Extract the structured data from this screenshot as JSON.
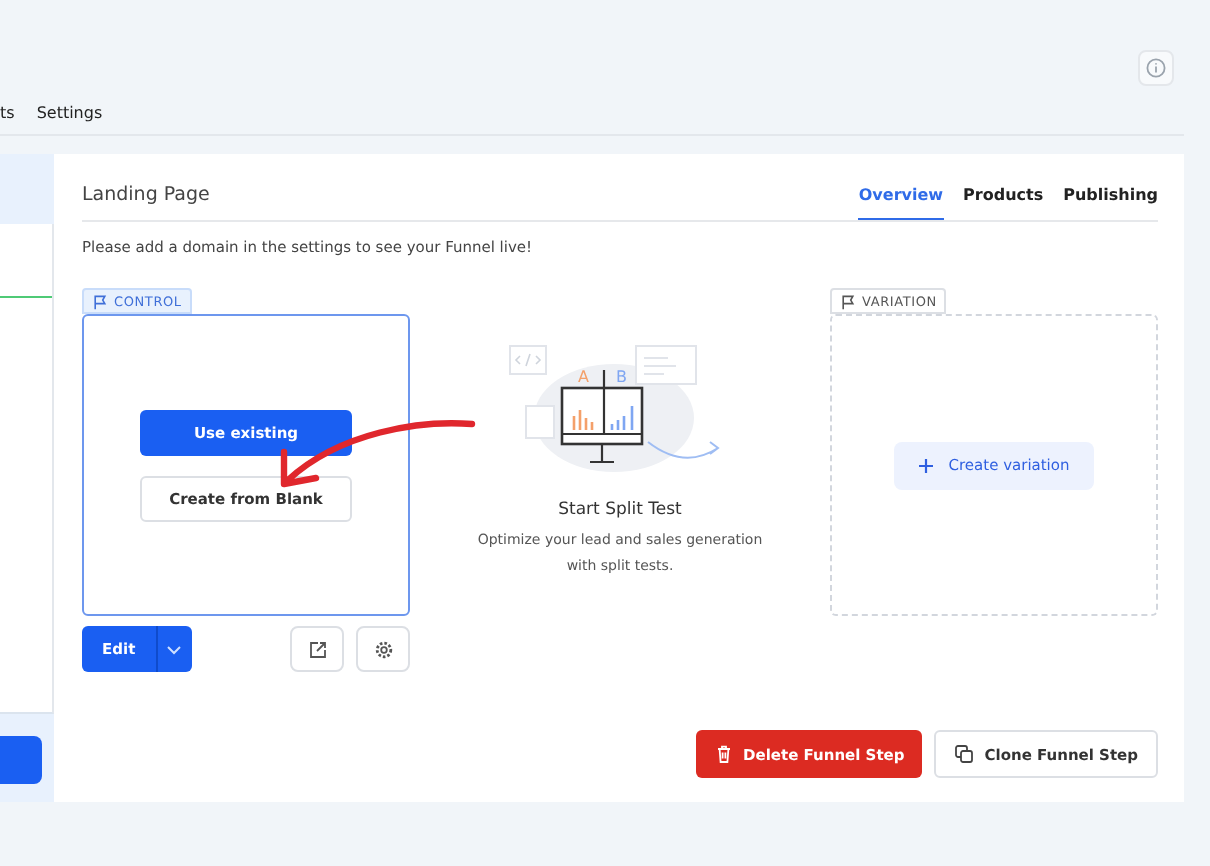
{
  "nav": [
    {
      "label": "ts",
      "selected": false
    },
    {
      "label": "Settings",
      "selected": false
    }
  ],
  "card": {
    "title": "Landing Page",
    "tabs": [
      {
        "label": "Overview",
        "selected": true
      },
      {
        "label": "Products",
        "selected": false
      },
      {
        "label": "Publishing",
        "selected": false
      }
    ],
    "notice": "Please add a domain in the settings to see your Funnel live!",
    "control": {
      "tag": "CONTROL",
      "buttons": [
        {
          "label": "Use existing",
          "kind": "primary"
        },
        {
          "label": "Create from Blank",
          "kind": "outline"
        }
      ],
      "edit": "Edit"
    },
    "split_test": {
      "variants": [
        "A",
        "B"
      ],
      "title": "Start Split Test",
      "description": "Optimize your lead and sales generation with split tests."
    },
    "variation": {
      "tag": "VARIATION",
      "button": "Create variation"
    },
    "actions": [
      {
        "label": "Delete Funnel Step",
        "kind": "danger"
      },
      {
        "label": "Clone Funnel Step",
        "kind": "secondary"
      }
    ]
  }
}
